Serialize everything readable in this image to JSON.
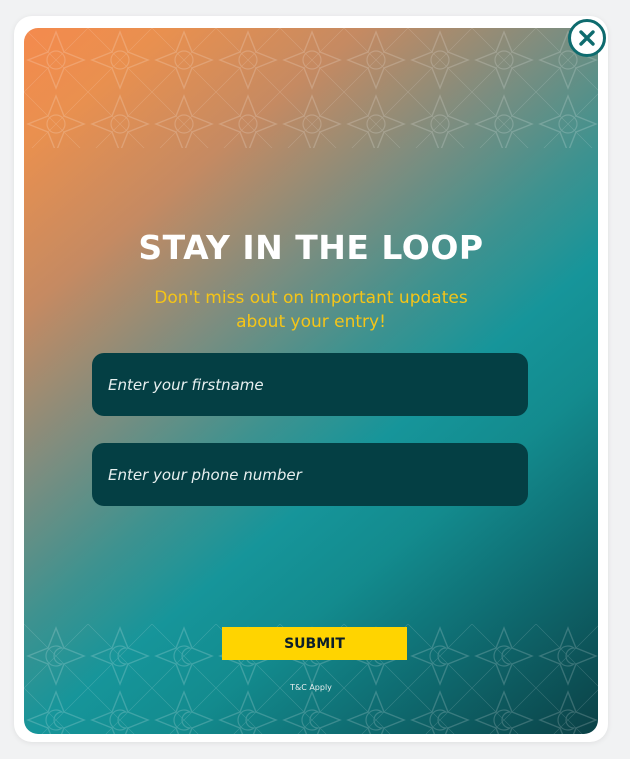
{
  "popup": {
    "heading": "STAY IN THE LOOP",
    "subheading": "Don't miss out on important updates about your entry!",
    "fields": [
      {
        "placeholder": "Enter your firstname",
        "value": ""
      },
      {
        "placeholder": "Enter your phone number",
        "value": ""
      }
    ],
    "submit_label": "SUBMIT",
    "terms_text": "T&C Apply",
    "close_icon": "close-icon"
  },
  "colors": {
    "accent_yellow": "#ffd400",
    "subheading_yellow": "#f5c518",
    "field_background": "#043f44",
    "close_ring": "#0e6b6e",
    "gradient_orange": "#f48a4e",
    "gradient_teal": "#16959a",
    "gradient_dark": "#0b4146"
  }
}
